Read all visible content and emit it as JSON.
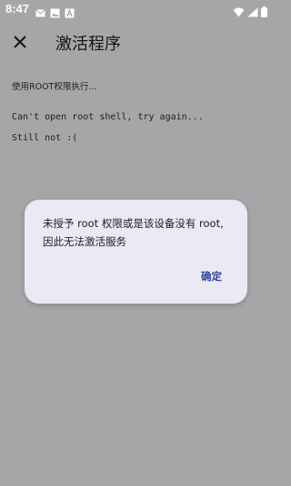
{
  "status_bar": {
    "time": "8:47",
    "icons": [
      "mail-icon",
      "image-icon",
      "a-icon",
      "wifi-icon",
      "signal-icon",
      "battery-icon"
    ]
  },
  "app_bar": {
    "title": "激活程序",
    "close_icon": "close-icon"
  },
  "content": {
    "status_text": "使用ROOT权限执行...",
    "log_lines": [
      "Can't open root shell, try again...",
      "Still not :("
    ]
  },
  "dialog": {
    "message": "未授予 root 权限或是该设备没有 root, 因此无法激活服务",
    "ok_label": "确定"
  },
  "colors": {
    "scrim": "#a6a5a8",
    "dialog_bg": "#eae9f4",
    "accent": "#34469a"
  }
}
